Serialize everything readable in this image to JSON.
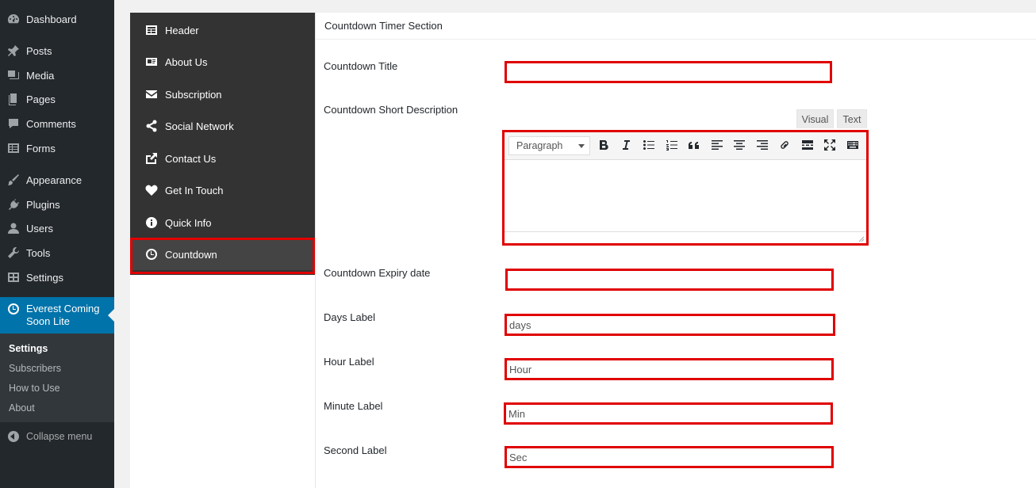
{
  "admin_menu": {
    "items": [
      {
        "label": "Dashboard",
        "icon": "dashboard-icon"
      },
      {
        "label": "Posts",
        "icon": "pin-icon"
      },
      {
        "label": "Media",
        "icon": "media-icon"
      },
      {
        "label": "Pages",
        "icon": "pages-icon"
      },
      {
        "label": "Comments",
        "icon": "comment-icon"
      },
      {
        "label": "Forms",
        "icon": "forms-icon"
      },
      {
        "label": "Appearance",
        "icon": "brush-icon"
      },
      {
        "label": "Plugins",
        "icon": "plugin-icon"
      },
      {
        "label": "Users",
        "icon": "user-icon"
      },
      {
        "label": "Tools",
        "icon": "wrench-icon"
      },
      {
        "label": "Settings",
        "icon": "settings-icon"
      }
    ],
    "current": {
      "label_line1": "Everest Coming",
      "label_line2": "Soon Lite",
      "icon": "clock-icon"
    },
    "submenu": [
      "Settings",
      "Subscribers",
      "How to Use",
      "About"
    ],
    "collapse_label": "Collapse menu"
  },
  "plugin_tabs": [
    {
      "label": "Header",
      "icon": "table-icon"
    },
    {
      "label": "About Us",
      "icon": "id-card-icon"
    },
    {
      "label": "Subscription",
      "icon": "envelope-icon"
    },
    {
      "label": "Social Network",
      "icon": "share-icon"
    },
    {
      "label": "Contact Us",
      "icon": "external-icon"
    },
    {
      "label": "Get In Touch",
      "icon": "heart-icon"
    },
    {
      "label": "Quick Info",
      "icon": "info-icon"
    },
    {
      "label": "Countdown",
      "icon": "clock-icon"
    }
  ],
  "section": {
    "title": "Countdown Timer Section",
    "fields": {
      "title": {
        "label": "Countdown Title",
        "value": ""
      },
      "short_description": {
        "label": "Countdown Short Description"
      },
      "expiry_date": {
        "label": "Countdown Expiry date",
        "value": ""
      },
      "days": {
        "label": "Days Label",
        "value": "days"
      },
      "hour": {
        "label": "Hour Label",
        "value": "Hour"
      },
      "minute": {
        "label": "Minute Label",
        "value": "Min"
      },
      "second": {
        "label": "Second Label",
        "value": "Sec"
      }
    },
    "editor": {
      "visual_tab": "Visual",
      "text_tab": "Text",
      "format": "Paragraph",
      "buttons": [
        "bold-icon",
        "italic-icon",
        "bullet-list-icon",
        "numbered-list-icon",
        "blockquote-icon",
        "align-left-icon",
        "align-center-icon",
        "align-right-icon",
        "link-icon",
        "read-more-icon",
        "fullscreen-icon",
        "toolbar-toggle-icon"
      ]
    }
  }
}
